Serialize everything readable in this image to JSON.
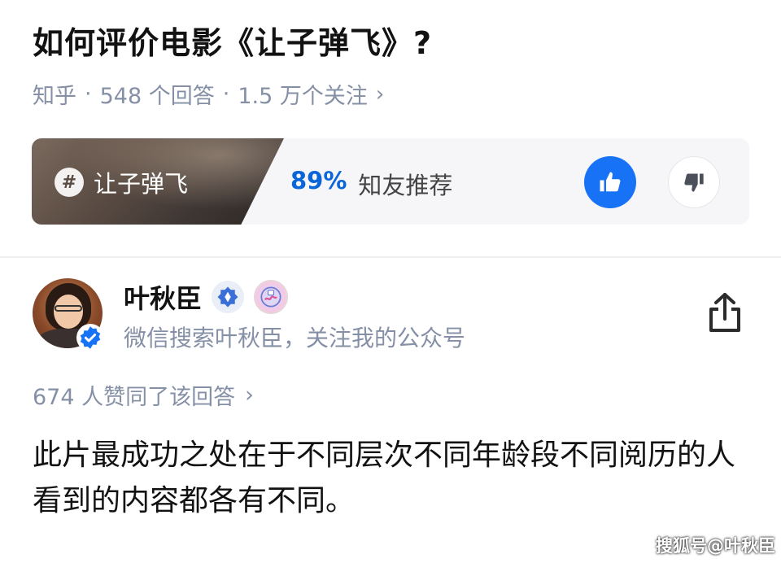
{
  "question": {
    "title": "如何评价电影《让子弹飞》?",
    "source": "知乎",
    "answers": "548 个回答",
    "followers": "1.5 万个关注",
    "separator": "·"
  },
  "topic_card": {
    "tag_label": "让子弹飞",
    "recommend_percent": "89%",
    "recommend_text": "知友推荐",
    "icons": [
      "hash-icon",
      "thumbs-up-icon",
      "thumbs-down-icon"
    ]
  },
  "answer": {
    "author_name": "叶秋臣",
    "author_bio": "微信搜索叶秋臣，关注我的公众号",
    "votes_text": "674 人赞同了该回答",
    "content": "此片最成功之处在于不同层次不同年龄段不同阅历的人看到的内容都各有不同。",
    "icons": [
      "verified-icon",
      "medal-badge-icon",
      "art-badge-icon",
      "share-icon"
    ]
  },
  "watermark": "搜狐号@叶秋臣",
  "colors": {
    "accent": "#1772f6",
    "percent": "#0a66d8",
    "meta": "#8590a6",
    "text": "#121212",
    "card_bg": "#f6f6f8"
  }
}
